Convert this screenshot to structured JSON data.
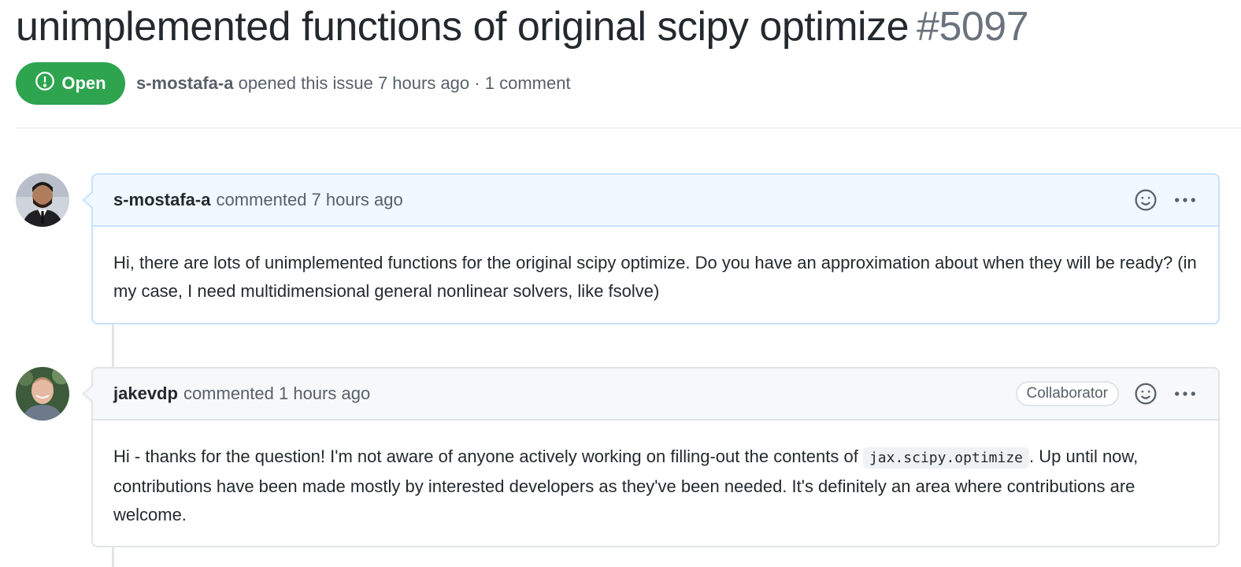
{
  "issue": {
    "title": "unimplemented functions of original scipy optimize",
    "number": "#5097",
    "state": "Open",
    "author": "s-mostafa-a",
    "opened_text": "opened this issue 7 hours ago",
    "separator": "·",
    "comment_count": "1 comment"
  },
  "comments": [
    {
      "author": "s-mostafa-a",
      "action": "commented 7 hours ago",
      "body": "Hi, there are lots of unimplemented functions for the original scipy optimize. Do you have an approximation about when they will be ready? (in my case, I need multidimensional general nonlinear solvers, like fsolve)"
    },
    {
      "author": "jakevdp",
      "action": "commented 1 hours ago",
      "role": "Collaborator",
      "body_part1": "Hi - thanks for the question! I'm not aware of anyone actively working on filling-out the contents of ",
      "body_code": "jax.scipy.optimize",
      "body_part2": ". Up until now, contributions have been made mostly by interested developers as they've been needed. It's definitely an area where contributions are welcome."
    }
  ],
  "colors": {
    "open_green": "#2ea44f",
    "header_blue": "#f1f8ff",
    "border_blue": "#c8e1ff",
    "header_gray": "#f6f8fa",
    "muted_text": "#586069"
  },
  "icons": {
    "state": "issue-opened-icon",
    "reaction": "smiley-icon",
    "more": "kebab-horizontal-icon"
  }
}
